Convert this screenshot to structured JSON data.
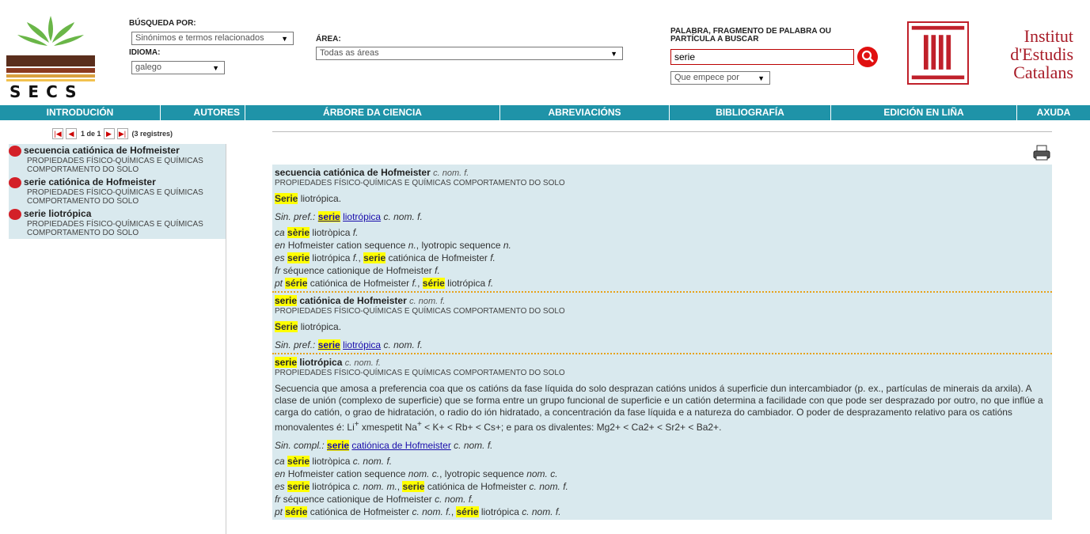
{
  "header": {
    "logo_text": "SECS",
    "search_by_label": "BÚSQUEDA POR:",
    "search_by_value": "Sinónimos e termos relacionados",
    "language_label": "IDIOMA:",
    "language_value": "galego",
    "area_label": "ÁREA:",
    "area_value": "Todas as áreas",
    "word_label": "PALABRA, FRAGMENTO DE PALABRA OU PARTÍCULA A BUSCAR",
    "word_value": "serie",
    "match_value": "Que empece por",
    "iec_line1": "Institut",
    "iec_line2": "d'Estudis",
    "iec_line3": "Catalans",
    "colors": {
      "nav": "#1f93a8",
      "result_bg": "#d9e9ee",
      "highlight": "#ffff00",
      "search_btn": "#e01010"
    }
  },
  "nav": [
    "INTRODUCIÓN",
    "AUTORES",
    "ÁRBORE DA CIENCIA",
    "ABREVIACIÓNS",
    "BIBLIOGRAFÍA",
    "EDICIÓN EN LIÑA",
    "AXUDA"
  ],
  "pager": {
    "text": "1 de 1",
    "count": "(3 registres)"
  },
  "results": [
    {
      "title": "secuencia catiónica de Hofmeister",
      "area": "PROPIEDADES FÍSICO-QUÍMICAS E QUÍMICAS COMPORTAMENTO DO SOLO"
    },
    {
      "title": "serie catiónica de Hofmeister",
      "area": "PROPIEDADES FÍSICO-QUÍMICAS E QUÍMICAS COMPORTAMENTO DO SOLO"
    },
    {
      "title": "serie liotrópica",
      "area": "PROPIEDADES FÍSICO-QUÍMICAS E QUÍMICAS COMPORTAMENTO DO SOLO"
    }
  ],
  "entries": {
    "e1": {
      "term": "secuencia catiónica de Hofmeister",
      "cat": "c. nom. f.",
      "area": "PROPIEDADES FÍSICO-QUÍMICAS E QUÍMICAS COMPORTAMENTO DO SOLO",
      "def_hl": "Serie",
      "def_rest": " liotrópica.",
      "syn_label": "Sin. pref.:",
      "syn_hl": "serie",
      "syn_link": "liotrópica",
      "syn_cat": "c. nom. f.",
      "ca_lang": "ca",
      "ca_hl": "sèrie",
      "ca_rest": " liotròpica ",
      "ca_cat": "f.",
      "en_lang": "en",
      "en_a": " Hofmeister cation sequence ",
      "en_cat1": "n.",
      "en_b": ", lyotropic sequence ",
      "en_cat2": "n.",
      "es_lang": "es",
      "es_hl1": "serie",
      "es_a": " liotrópica ",
      "es_cat1": "f.",
      "es_sep": ", ",
      "es_hl2": "serie",
      "es_b": " catiónica de Hofmeister ",
      "es_cat2": "f.",
      "fr_lang": "fr",
      "fr_a": " séquence cationique de Hofmeister ",
      "fr_cat": "f.",
      "pt_lang": "pt",
      "pt_hl1": "série",
      "pt_a": " catiónica de Hofmeister ",
      "pt_cat1": "f.",
      "pt_sep": ", ",
      "pt_hl2": "série",
      "pt_b": " liotrópica ",
      "pt_cat2": "f."
    },
    "e2": {
      "term_hl": "serie",
      "term_rest": " catiónica de Hofmeister",
      "cat": "c. nom. f.",
      "area": "PROPIEDADES FÍSICO-QUÍMICAS E QUÍMICAS COMPORTAMENTO DO SOLO",
      "def_hl": "Serie",
      "def_rest": " liotrópica.",
      "syn_label": "Sin. pref.:",
      "syn_hl": "serie",
      "syn_link": "liotrópica",
      "syn_cat": "c. nom. f."
    },
    "e3": {
      "term_hl": "serie",
      "term_rest": " liotrópica",
      "cat": "c. nom. f.",
      "area": "PROPIEDADES FÍSICO-QUÍMICAS E QUÍMICAS COMPORTAMENTO DO SOLO",
      "def_text": "Secuencia que amosa a preferencia coa que os catións da fase líquida do solo desprazan catións unidos á superficie dun intercambiador (p. ex., partículas de minerais da arxila). A clase de unión (complexo de superficie) que se forma entre un grupo funcional de superficie e un catión determina a facilidade con que pode ser desprazado por outro, no que inflúe a carga do catión, o grao de hidratación, o radio do ión hidratado, a concentración da fase líquida e a natureza do cambiador. O poder de desprazamento relativo para os catións monovalentes é: Li",
      "def_tail": "xmespetit Na",
      "def_mono": "< K+ < Rb+ < Cs+",
      "def_mid": "; e para os divalentes: ",
      "def_di": "Mg2+ < Ca2+ < Sr2+ < Ba2+.",
      "compl_label": "Sin. compl.:",
      "compl_hl": "serie",
      "compl_link": "catiónica de Hofmeister",
      "compl_cat": "c. nom. f.",
      "ca_lang": "ca",
      "ca_hl": "sèrie",
      "ca_rest": " liotròpica ",
      "ca_cat": "c. nom. f.",
      "en_lang": "en",
      "en_a": " Hofmeister cation sequence ",
      "en_cat1": "nom. c.",
      "en_b": ", lyotropic sequence ",
      "en_cat2": "nom. c.",
      "es_lang": "es",
      "es_hl1": "serie",
      "es_a": " liotrópica ",
      "es_cat1": "c. nom. m.",
      "es_sep": ", ",
      "es_hl2": "serie",
      "es_b": " catiónica de Hofmeister ",
      "es_cat2": "c. nom. f.",
      "fr_lang": "fr",
      "fr_a": " séquence cationique de Hofmeister ",
      "fr_cat": "c. nom. f.",
      "pt_lang": "pt",
      "pt_hl1": "série",
      "pt_a": " catiónica de Hofmeister ",
      "pt_cat1": "c. nom. f.",
      "pt_sep": ", ",
      "pt_hl2": "série",
      "pt_b": " liotrópica ",
      "pt_cat2": "c. nom. f."
    }
  }
}
